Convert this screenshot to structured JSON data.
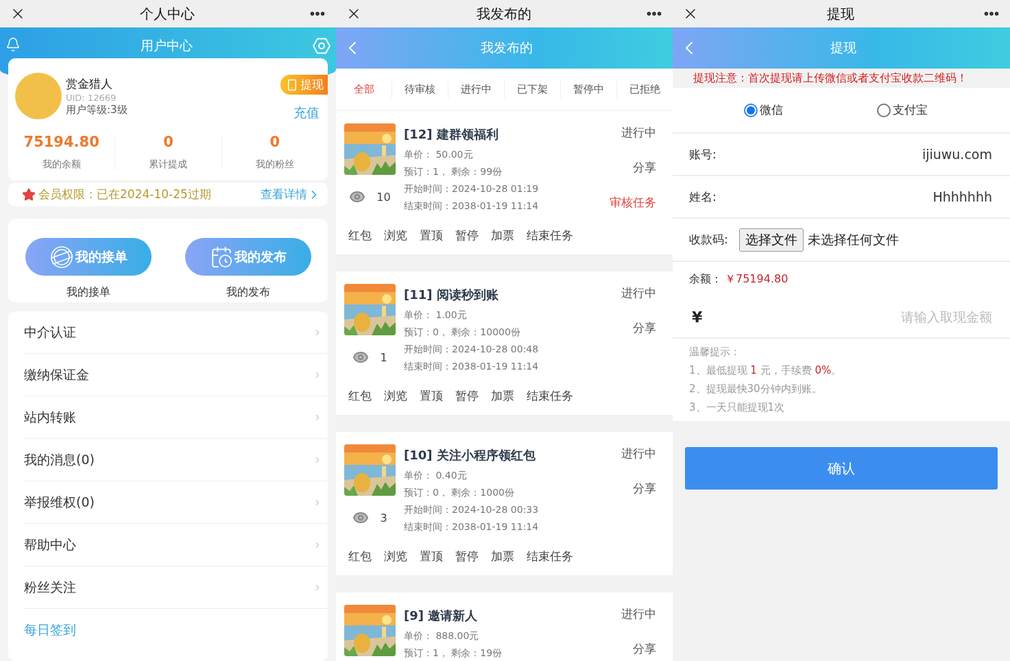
{
  "profile": {
    "window": {
      "title": "个人中心"
    },
    "header": {
      "title": "用户中心"
    },
    "user": {
      "name": "赏金猎人",
      "uid": "UID: 12669",
      "level": "用户等级:3级",
      "withdraw": "提现",
      "recharge": "充值"
    },
    "stats": [
      {
        "value": "75194.80",
        "label": "我的余额"
      },
      {
        "value": "0",
        "label": "累计提成"
      },
      {
        "value": "0",
        "label": "我的粉丝"
      }
    ],
    "membership": {
      "label": "会员权限：",
      "value": "已在2024-10-25过期",
      "link": "查看详情"
    },
    "shortcuts": [
      {
        "kind": "stamp",
        "label": "我的接单",
        "caption": "我的接单"
      },
      {
        "kind": "calendar",
        "label": "我的发布",
        "caption": "我的发布"
      }
    ],
    "menu": [
      {
        "kind": "plain",
        "label": "中介认证"
      },
      {
        "kind": "plain",
        "label": "缴纳保证金"
      },
      {
        "kind": "plain",
        "label": "站内转账"
      },
      {
        "kind": "plain",
        "label": "我的消息(0)"
      },
      {
        "kind": "plain",
        "label": "举报维权(0)"
      },
      {
        "kind": "plain",
        "label": "帮助中心"
      },
      {
        "kind": "plain",
        "label": "粉丝关注"
      },
      {
        "kind": "link",
        "label": "每日签到"
      }
    ]
  },
  "tasks": {
    "window": {
      "title": "我发布的"
    },
    "header": {
      "title": "我发布的"
    },
    "tabs": [
      {
        "label": "全部",
        "selected": true
      },
      {
        "label": "待审核",
        "selected": false
      },
      {
        "label": "进行中",
        "selected": false
      },
      {
        "label": "已下架",
        "selected": false
      },
      {
        "label": "暂停中",
        "selected": false
      },
      {
        "label": "已拒绝",
        "selected": false
      }
    ],
    "items": [
      {
        "title": "[12] 建群领福利",
        "price": "单价：  50.00元",
        "stock": "预订：1，  剩余：99份",
        "start": "开始时间：2024-10-28 01:19",
        "end": "结束时间：2038-01-19 11:14",
        "views": "10",
        "status": "进行中",
        "share": "分享",
        "review": "审核任务",
        "actions": [
          "红包",
          "浏览",
          "置顶",
          "暂停",
          "加票",
          "结束任务"
        ]
      },
      {
        "title": "[11] 阅读秒到账",
        "price": "单价：  1.00元",
        "stock": "预订：0，  剩余：10000份",
        "start": "开始时间：2024-10-28 00:48",
        "end": "结束时间：2038-01-19 11:14",
        "views": "1",
        "status": "进行中",
        "share": "分享",
        "actions": [
          "红包",
          "浏览",
          "置顶",
          "暂停",
          "加票",
          "结束任务"
        ]
      },
      {
        "title": "[10] 关注小程序领红包",
        "price": "单价：  0.40元",
        "stock": "预订：0，  剩余：1000份",
        "start": "开始时间：2024-10-28 00:33",
        "end": "结束时间：2038-01-19 11:14",
        "views": "3",
        "status": "进行中",
        "share": "分享",
        "actions": [
          "红包",
          "浏览",
          "置顶",
          "暂停",
          "加票",
          "结束任务"
        ]
      },
      {
        "title": "[9] 邀请新人",
        "price": "单价：  888.00元",
        "stock": "预订：1，  剩余：19份",
        "status": "进行中",
        "share": "分享"
      }
    ]
  },
  "withdraw": {
    "window": {
      "title": "提现"
    },
    "header": {
      "title": "提现"
    },
    "notice": "提现注意：首次提现请上传微信或者支付宝收款二维码！",
    "methods": [
      {
        "label": "微信",
        "selected": true
      },
      {
        "label": "支付宝",
        "selected": false
      }
    ],
    "fields": [
      {
        "label": "账号:",
        "value": "ijiuwu.com"
      },
      {
        "label": "姓名:",
        "value": "Hhhhhhh"
      }
    ],
    "upload": {
      "label": "收款码:",
      "button": "选择文件",
      "status": "未选择任何文件"
    },
    "balance": {
      "label": "余额：",
      "value": "￥75194.80"
    },
    "amount": {
      "currency": "¥",
      "placeholder": "请输入取现金额"
    },
    "tips": {
      "title": "温馨提示：",
      "lines": [
        [
          {
            "text": "1、最低提现 ",
            "highlight": false
          },
          {
            "text": "1",
            "highlight": true
          },
          {
            "text": " 元，手续费 ",
            "highlight": false
          },
          {
            "text": "0%",
            "highlight": true
          },
          {
            "text": "。",
            "highlight": false
          }
        ],
        [
          {
            "text": "2、提现最快30分钟内到账。",
            "highlight": false
          }
        ],
        [
          {
            "text": "3、一天只能提现1次",
            "highlight": false
          }
        ]
      ]
    },
    "confirm": "确认"
  }
}
